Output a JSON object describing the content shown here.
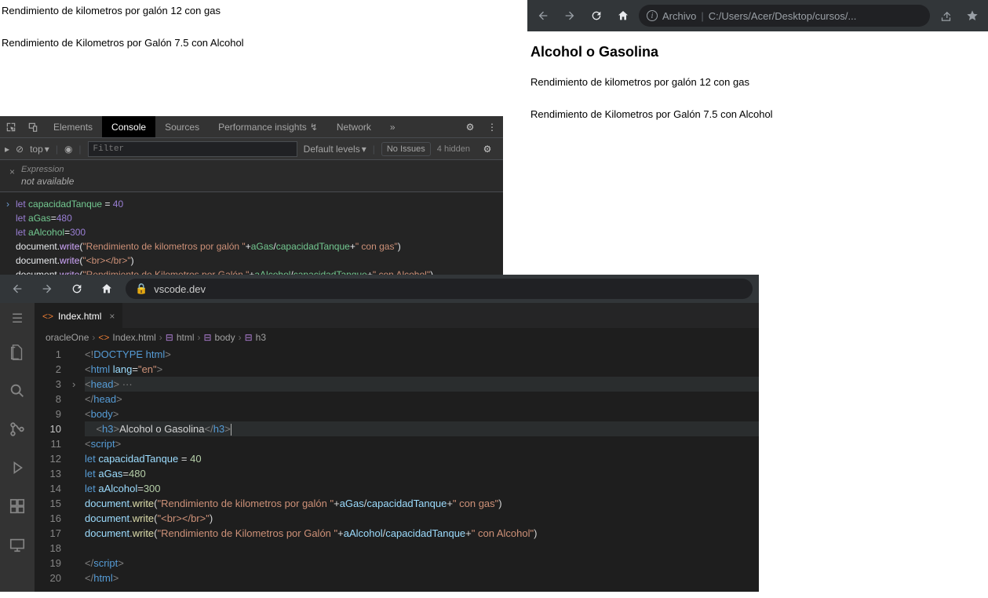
{
  "output": {
    "line1": "Rendimiento de kilometros por galón 12 con gas",
    "line2": "Rendimiento de Kilometros por Galón 7.5 con Alcohol"
  },
  "browser": {
    "addr_prefix": "Archivo",
    "addr_path": "C:/Users/Acer/Desktop/cursos/...",
    "heading": "Alcohol o Gasolina",
    "line1": "Rendimiento de kilometros por galón 12 con gas",
    "line2": "Rendimiento de Kilometros por Galón 7.5 con Alcohol"
  },
  "devtools": {
    "tabs": [
      "Elements",
      "Console",
      "Sources",
      "Performance insights",
      "Network"
    ],
    "top_label": "top",
    "filter_placeholder": "Filter",
    "levels": "Default levels",
    "issues": "No Issues",
    "hidden": "4 hidden",
    "expr_label": "Expression",
    "expr_na": "not available",
    "console_lines": [
      "let capacidadTanque = 40",
      "let aGas=480",
      "let aAlcohol=300",
      "document.write(\"Rendimiento de kilometros por galón \"+aGas/capacidadTanque+\" con gas\")",
      "document.write(\"<br></br>\")",
      "document.write(\"Rendimiento de Kilometros por Galón \"+aAlcohol/capacidadTanque+\" con Alcohol\")"
    ]
  },
  "vscode": {
    "addr": "vscode.dev",
    "tab": "Index.html",
    "crumbs": [
      "oracleOne",
      "Index.html",
      "html",
      "body",
      "h3"
    ],
    "line_numbers": [
      "1",
      "2",
      "3",
      "8",
      "9",
      "10",
      "11",
      "12",
      "13",
      "14",
      "15",
      "16",
      "17",
      "18",
      "19",
      "20"
    ],
    "code": {
      "l1_a": "<!",
      "l1_b": "DOCTYPE",
      "l1_c": " html",
      "l1_d": ">",
      "l2_a": "<",
      "l2_b": "html",
      "l2_c": " lang",
      "l2_d": "=",
      "l2_e": "\"en\"",
      "l2_f": ">",
      "l3_a": "<",
      "l3_b": "head",
      "l3_c": ">",
      "l3_d": " ···",
      "l8_a": "</",
      "l8_b": "head",
      "l8_c": ">",
      "l9_a": "<",
      "l9_b": "body",
      "l9_c": ">",
      "l10_a": "    <",
      "l10_b": "h3",
      "l10_c": ">",
      "l10_d": "Alcohol o Gasolina",
      "l10_e": "</",
      "l10_f": "h3",
      "l10_g": ">",
      "l11_a": "<",
      "l11_b": "script",
      "l11_c": ">",
      "l12_a": "let",
      "l12_b": " capacidadTanque ",
      "l12_c": "=",
      "l12_d": " 40",
      "l13_a": "let",
      "l13_b": " aGas",
      "l13_c": "=",
      "l13_d": "480",
      "l14_a": "let",
      "l14_b": " aAlcohol",
      "l14_c": "=",
      "l14_d": "300",
      "l15_a": "document",
      "l15_b": ".",
      "l15_c": "write",
      "l15_d": "(",
      "l15_e": "\"Rendimiento de kilometros por galón \"",
      "l15_f": "+",
      "l15_g": "aGas",
      "l15_h": "/",
      "l15_i": "capacidadTanque",
      "l15_j": "+",
      "l15_k": "\" con gas\"",
      "l15_l": ")",
      "l16_a": "document",
      "l16_b": ".",
      "l16_c": "write",
      "l16_d": "(",
      "l16_e": "\"<br></br>\"",
      "l16_f": ")",
      "l17_a": "document",
      "l17_b": ".",
      "l17_c": "write",
      "l17_d": "(",
      "l17_e": "\"Rendimiento de Kilometros por Galón \"",
      "l17_f": "+",
      "l17_g": "aAlcohol",
      "l17_h": "/",
      "l17_i": "capacidadTanque",
      "l17_j": "+",
      "l17_k": "\" con Alcohol\"",
      "l17_l": ")",
      "l19_a": "</",
      "l19_b": "script",
      "l19_c": ">",
      "l20_a": "</",
      "l20_b": "html",
      "l20_c": ">"
    }
  }
}
